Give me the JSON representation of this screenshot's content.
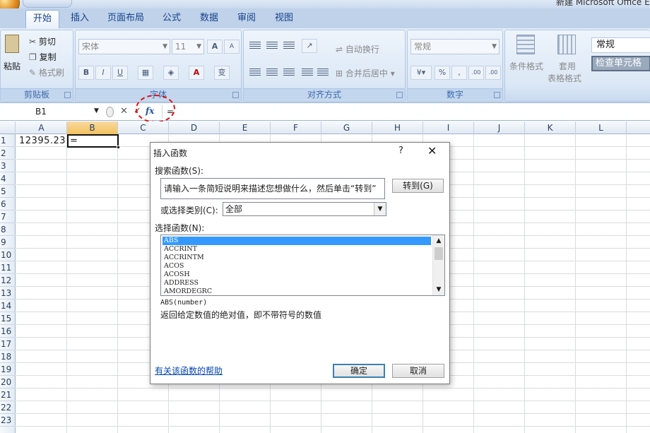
{
  "window": {
    "title": "新建 Microsoft Office E"
  },
  "tabs": [
    {
      "label": "开始",
      "active": true
    },
    {
      "label": "插入"
    },
    {
      "label": "页面布局"
    },
    {
      "label": "公式"
    },
    {
      "label": "数据"
    },
    {
      "label": "审阅"
    },
    {
      "label": "视图"
    }
  ],
  "ribbon": {
    "clipboard": {
      "label": "剪贴板",
      "paste": "粘贴",
      "cut": "剪切",
      "copy": "复制",
      "format_painter": "格式刷"
    },
    "font": {
      "label": "字体",
      "font_name": "宋体",
      "font_size": "11",
      "grow": "A",
      "shrink": "A",
      "bold": "B",
      "italic": "I",
      "underline": "U",
      "phonetic": "变"
    },
    "alignment": {
      "label": "对齐方式",
      "wrap_text": "自动换行",
      "merge_center": "合并后居中"
    },
    "number": {
      "label": "数字",
      "format": "常规",
      "percent": "%",
      "comma": ",",
      "inc_decimal": ".00",
      "dec_decimal": ".00"
    },
    "styles": {
      "conditional": "条件格式",
      "table_format_1": "套用",
      "table_format_2": "表格格式",
      "normal_style": "常规",
      "check_cell": "检查单元格"
    }
  },
  "formula_bar": {
    "name_box": "B1",
    "cancel": "✕",
    "enter": "✓",
    "fx": "fx",
    "formula": "="
  },
  "grid": {
    "columns": [
      "A",
      "B",
      "C",
      "D",
      "E",
      "F",
      "G",
      "H",
      "I",
      "J",
      "K",
      "L"
    ],
    "selected_column": "B",
    "rows": [
      "1",
      "2",
      "3",
      "4",
      "5",
      "6",
      "7",
      "8",
      "9",
      "10",
      "11",
      "12",
      "13",
      "14",
      "15",
      "16",
      "17",
      "18",
      "19",
      "20",
      "21",
      "22",
      "23"
    ],
    "cells": {
      "A1": "12395.23",
      "B1": "="
    }
  },
  "dialog": {
    "title": "插入函数",
    "help": "?",
    "close": "✕",
    "search_label": "搜索函数(S):",
    "search_value": "请输入一条简短说明来描述您想做什么，然后单击“转到”",
    "go_button": "转到(G)",
    "category_label": "或选择类别(C):",
    "category_value": "全部",
    "select_label": "选择函数(N):",
    "functions": [
      "ABS",
      "ACCRINT",
      "ACCRINTM",
      "ACOS",
      "ACOSH",
      "ADDRESS",
      "AMORDEGRC"
    ],
    "selected_function": "ABS",
    "signature": "ABS(number)",
    "description": "返回给定数值的绝对值，即不带符号的数值",
    "help_link": "有关该函数的帮助",
    "ok": "确定",
    "cancel": "取消"
  },
  "colors": {
    "ribbon": "#dae6f4",
    "accent": "#15428b",
    "selection": "#3399ff",
    "highlight_circle": "#e01010"
  }
}
